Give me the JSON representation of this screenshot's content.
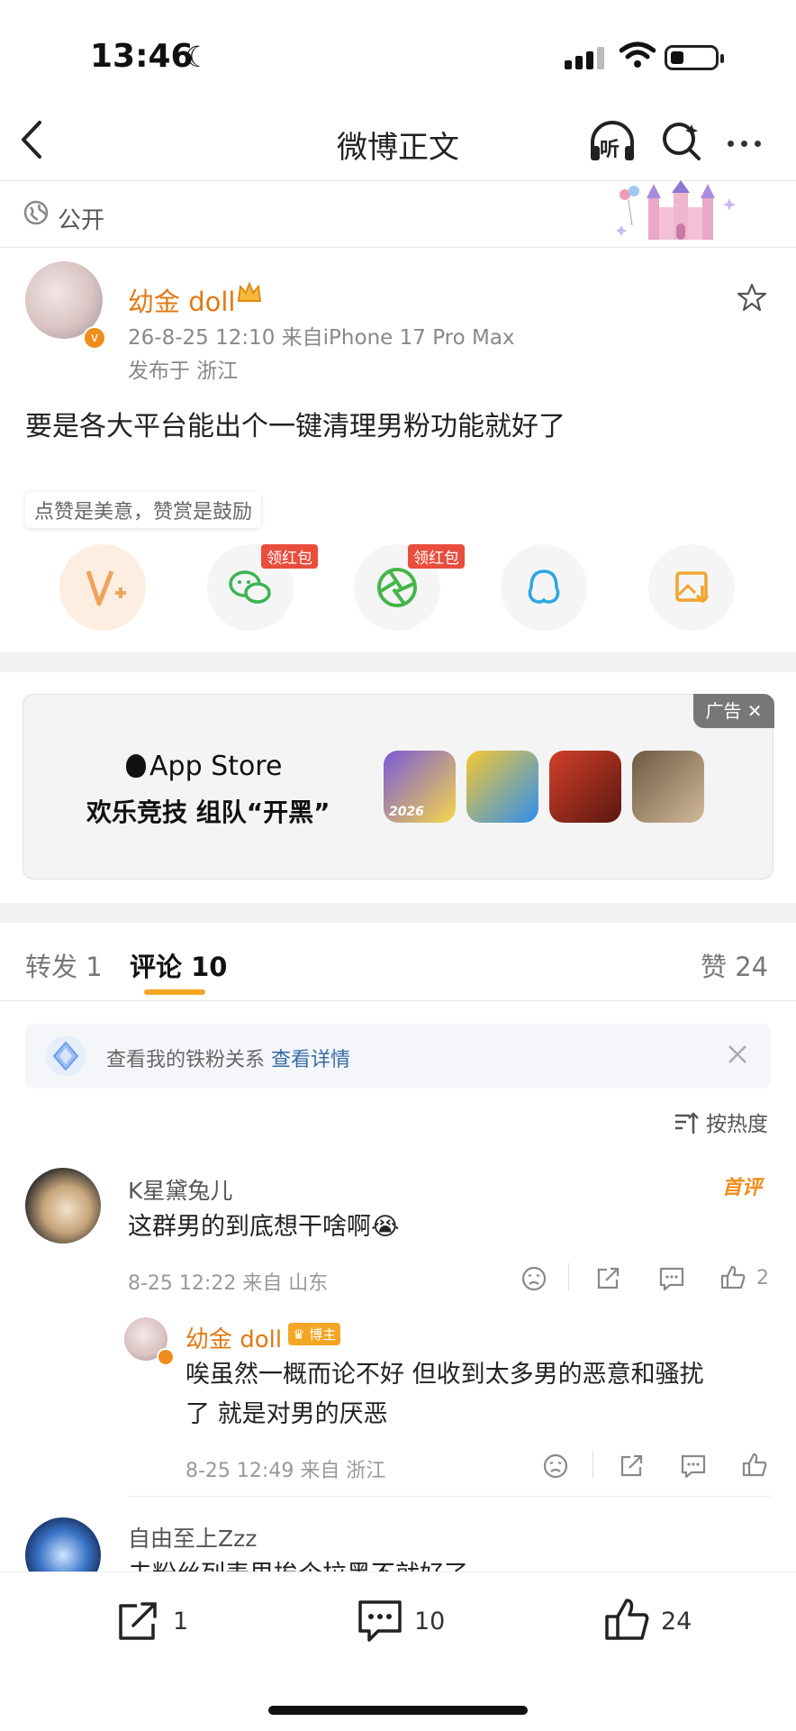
{
  "status_bar": {
    "time": "13:46"
  },
  "nav": {
    "title": "微博正文",
    "listen_label": "听"
  },
  "visibility": {
    "label": "公开"
  },
  "post": {
    "author": "幼金 doll",
    "meta": "26-8-25 12:10  来自iPhone 17 Pro Max",
    "location": "发布于 浙江",
    "text": "要是各大平台能出个一键清理男粉功能就好了"
  },
  "reward_tip": "点赞是美意，赞赏是鼓励",
  "share": {
    "red_packet_label": "领红包"
  },
  "ad": {
    "tag": "广告",
    "brand": "App Store",
    "slogan": "欢乐竞技 组队“开黑”",
    "game_badge": "2026"
  },
  "tabs": {
    "repost_label": "转发",
    "repost_count": "1",
    "comment_label": "评论",
    "comment_count": "10",
    "like_label": "赞",
    "like_count": "24"
  },
  "fan_box": {
    "text": "查看我的铁粉关系",
    "link": "查看详情"
  },
  "sort_label": "按热度",
  "comments": [
    {
      "name": "K星黛兔儿",
      "badge": "首评",
      "text": "这群男的到底想干啥啊😭",
      "meta": "8-25 12:22  来自 山东",
      "likes": "2"
    },
    {
      "name": "自由至上Zzz",
      "text": "去粉丝列表里挨个拉黑不就好了"
    }
  ],
  "reply": {
    "name": "幼金 doll",
    "badge": "博主",
    "text_line1": "唉虽然一概而论不好 但收到太多男的恶意和骚扰",
    "text_line2": "了 就是对男的厌恶",
    "meta": "8-25 12:49  来自 浙江"
  },
  "bottom_bar": {
    "repost": "1",
    "comment": "10",
    "like": "24"
  },
  "colors": {
    "accent": "#e37814",
    "link": "#386aa6",
    "tab_underline": "#f3a522"
  }
}
